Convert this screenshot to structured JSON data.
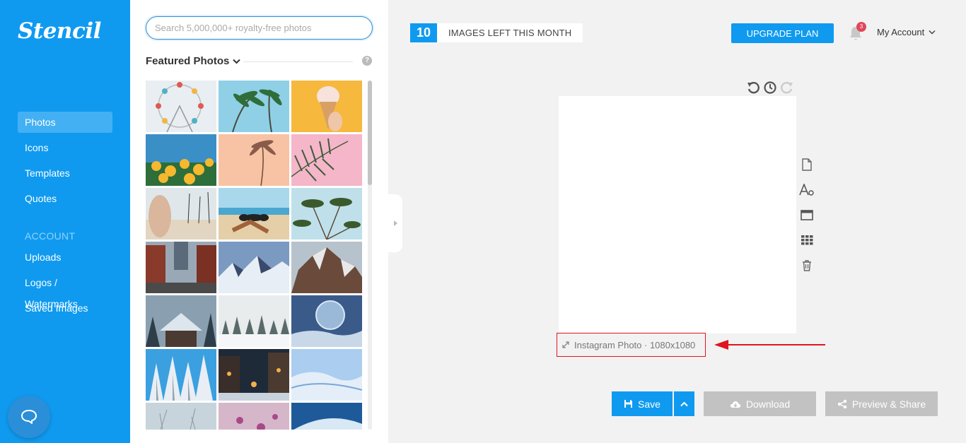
{
  "app": {
    "logo": "Stencil"
  },
  "sidebar": {
    "items": [
      {
        "label": "Photos",
        "active": true
      },
      {
        "label": "Icons"
      },
      {
        "label": "Templates"
      },
      {
        "label": "Quotes"
      }
    ],
    "section_label": "ACCOUNT",
    "account_items": [
      {
        "label": "Uploads"
      },
      {
        "label": "Logos / Watermarks"
      },
      {
        "label": "Saved Images"
      }
    ]
  },
  "photos": {
    "search_placeholder": "Search 5,000,000+ royalty-free photos",
    "featured_title": "Featured Photos",
    "help": "?",
    "thumbnails": [
      "ferris-wheel",
      "palm-trees-blue-sky",
      "ice-cream-cone",
      "yellow-flowers",
      "palm-peach-sky",
      "palm-leaf-pink",
      "beach-hand-palms",
      "sunglasses-sand",
      "palms-from-below",
      "city-bridge-street",
      "snowy-mountains",
      "rocky-mountain",
      "snowy-cabin",
      "foggy-snow-forest",
      "frozen-bubble",
      "snow-trees",
      "snowy-street-night",
      "snow-dunes",
      "frost-plant",
      "pink-blossom",
      "ocean-wave"
    ]
  },
  "topbar": {
    "images_left_count": "10",
    "images_left_label": "IMAGES LEFT THIS MONTH",
    "upgrade_label": "UPGRADE PLAN",
    "notification_count": "3",
    "account_label": "My Account"
  },
  "canvas": {
    "size_label": "Instagram Photo · 1080x1080"
  },
  "actions": {
    "save_label": "Save",
    "download_label": "Download",
    "share_label": "Preview & Share"
  },
  "colors": {
    "brand": "#0f9af0",
    "disabled_button": "#c2c2c2",
    "highlight_red": "#e0141e"
  }
}
